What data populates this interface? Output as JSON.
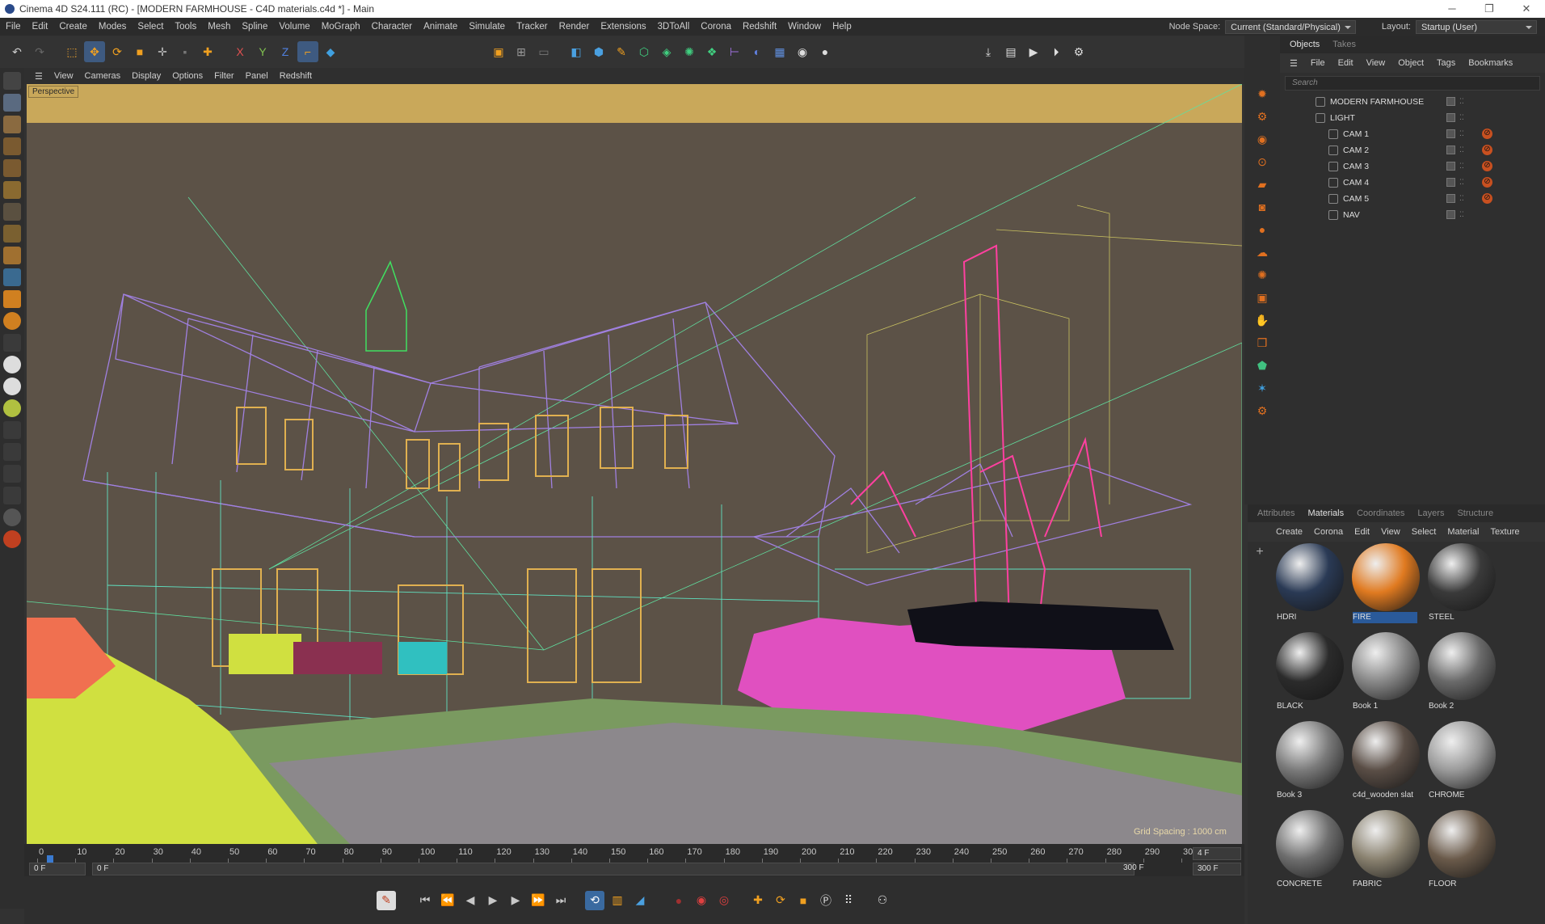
{
  "title": "Cinema 4D S24.111 (RC) - [MODERN FARMHOUSE - C4D materials.c4d *] - Main",
  "menu": [
    "File",
    "Edit",
    "Create",
    "Modes",
    "Select",
    "Tools",
    "Mesh",
    "Spline",
    "Volume",
    "MoGraph",
    "Character",
    "Animate",
    "Simulate",
    "Tracker",
    "Render",
    "Extensions",
    "3DToAll",
    "Corona",
    "Redshift",
    "Window",
    "Help"
  ],
  "node_space": {
    "label": "Node Space:",
    "value": "Current (Standard/Physical)"
  },
  "layout": {
    "label": "Layout:",
    "value": "Startup (User)"
  },
  "viewport_menu": [
    "View",
    "Cameras",
    "Display",
    "Options",
    "Filter",
    "Panel",
    "Redshift"
  ],
  "viewport_label": "Perspective",
  "grid_spacing": "Grid Spacing : 1000 cm",
  "timeline": {
    "ticks": [
      "0",
      "10",
      "20",
      "30",
      "40",
      "50",
      "60",
      "70",
      "80",
      "90",
      "100",
      "110",
      "120",
      "130",
      "140",
      "150",
      "160",
      "170",
      "180",
      "190",
      "200",
      "210",
      "220",
      "230",
      "240",
      "250",
      "260",
      "270",
      "280",
      "290",
      "30"
    ],
    "current_frame": "4 F",
    "start_field": "0 F",
    "min_field": "0 F",
    "end_field": "300 F",
    "max_field": "300 F"
  },
  "object_panel": {
    "tabs": [
      "Objects",
      "Takes"
    ],
    "menu": [
      "File",
      "Edit",
      "View",
      "Object",
      "Tags",
      "Bookmarks"
    ],
    "search_placeholder": "Search",
    "objects": [
      {
        "name": "MODERN FARMHOUSE",
        "tag": false
      },
      {
        "name": "LIGHT",
        "tag": false
      },
      {
        "name": "CAM 1",
        "tag": true
      },
      {
        "name": "CAM 2",
        "tag": true
      },
      {
        "name": "CAM 3",
        "tag": true
      },
      {
        "name": "CAM 4",
        "tag": true
      },
      {
        "name": "CAM 5",
        "tag": true
      },
      {
        "name": "NAV",
        "tag": false
      }
    ]
  },
  "material_panel": {
    "tabs": [
      "Attributes",
      "Materials",
      "Coordinates",
      "Layers",
      "Structure"
    ],
    "menu": [
      "Create",
      "Corona",
      "Edit",
      "View",
      "Select",
      "Material",
      "Texture"
    ],
    "materials": [
      {
        "name": "HDRI",
        "color": "#2a3a55"
      },
      {
        "name": "FIRE",
        "color": "#e07a20"
      },
      {
        "name": "STEEL",
        "color": "#3a3a3a"
      },
      {
        "name": "BLACK",
        "color": "#2b2b2b"
      },
      {
        "name": "Book 1",
        "color": "#888888"
      },
      {
        "name": "Book 2",
        "color": "#6a6a6a"
      },
      {
        "name": "Book 3",
        "color": "#7a7a7a"
      },
      {
        "name": "c4d_wooden slat",
        "color": "#5a4e46"
      },
      {
        "name": "CHROME",
        "color": "#9a9a9a"
      },
      {
        "name": "CONCRETE",
        "color": "#6e6e6e"
      },
      {
        "name": "FABRIC",
        "color": "#8a8270"
      },
      {
        "name": "FLOOR",
        "color": "#6a5a4a"
      }
    ]
  }
}
